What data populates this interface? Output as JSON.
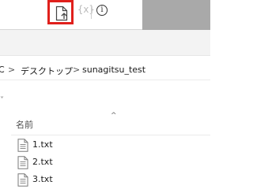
{
  "toolbar": {
    "new_file_icon": "new-file-icon",
    "braces_text": "{x}",
    "info_text": "i",
    "highlight_color": "#e0201c"
  },
  "breadcrumb": {
    "partial_root": "C",
    "items": [
      "デスクトップ",
      "sunagitsu_test"
    ],
    "separator": ">"
  },
  "left_pane": {
    "partial_label": "˅"
  },
  "file_list": {
    "column_header": "名前",
    "sort_indicator": "^",
    "files": [
      "1.txt",
      "2.txt",
      "3.txt"
    ]
  }
}
